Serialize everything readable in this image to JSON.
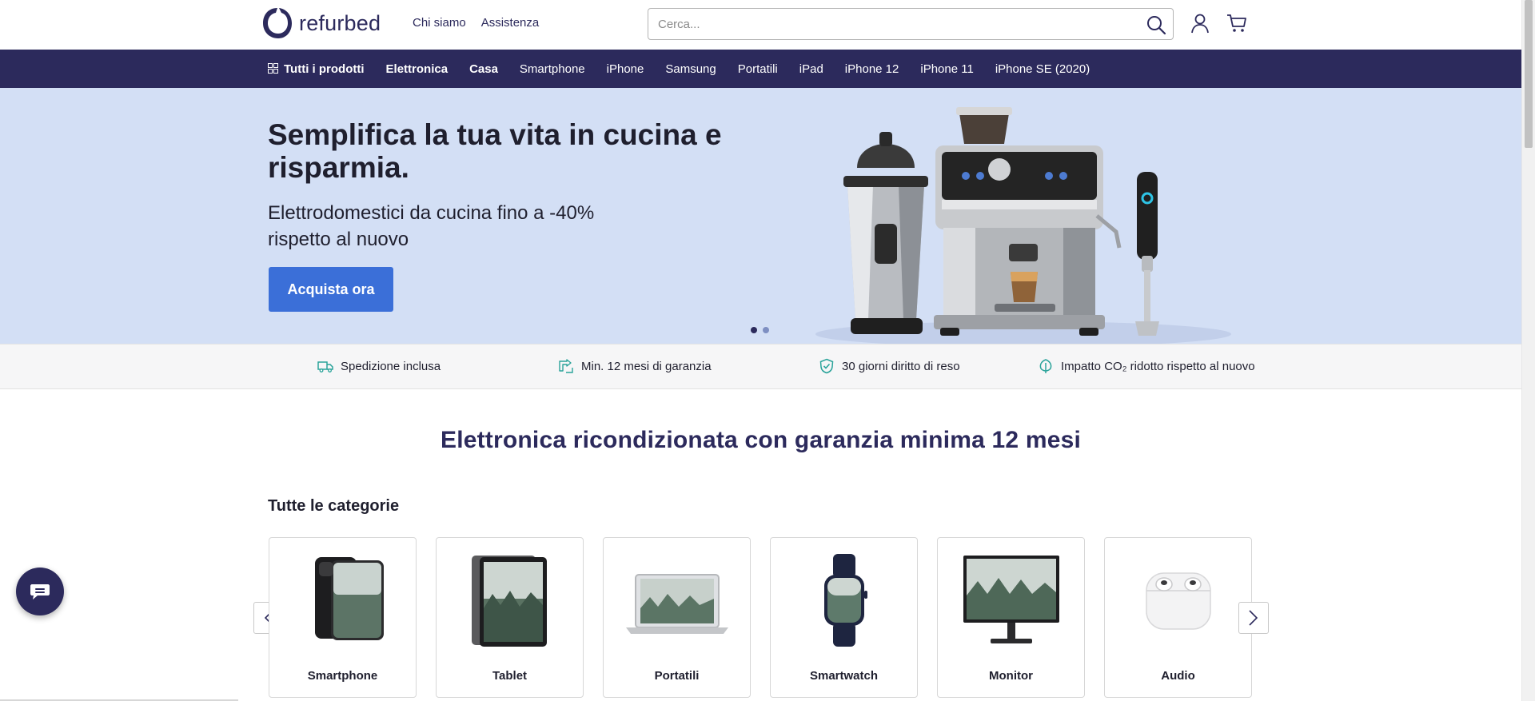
{
  "header": {
    "logo_text": "refurbed",
    "links": [
      "Chi siamo",
      "Assistenza"
    ],
    "search_placeholder": "Cerca..."
  },
  "nav": {
    "items": [
      "Tutti i prodotti",
      "Elettronica",
      "Casa",
      "Smartphone",
      "iPhone",
      "Samsung",
      "Portatili",
      "iPad",
      "iPhone 12",
      "iPhone 11",
      "iPhone SE (2020)"
    ],
    "bold_count": 3
  },
  "hero": {
    "title": "Semplifica la tua vita in cucina e risparmia.",
    "subtitle": "Elettrodomestici da cucina fino a -40% rispetto al nuovo",
    "button_label": "Acquista ora",
    "slides": 2,
    "active_slide": 1,
    "bg_color": "#d3dff5"
  },
  "benefits": [
    {
      "icon": "truck-icon",
      "label": "Spedizione inclusa"
    },
    {
      "icon": "warranty-icon",
      "label": "Min. 12 mesi di garanzia"
    },
    {
      "icon": "shield-check-icon",
      "label": "30 giorni diritto di reso"
    },
    {
      "icon": "leaf-icon",
      "label": "Impatto CO₂ ridotto rispetto al nuovo"
    }
  ],
  "section": {
    "title": "Elettronica ricondizionata con garanzia minima 12 mesi",
    "categories_heading": "Tutte le categorie",
    "categories": [
      {
        "label": "Smartphone",
        "icon": "smartphone-image"
      },
      {
        "label": "Tablet",
        "icon": "tablet-image"
      },
      {
        "label": "Portatili",
        "icon": "laptop-image"
      },
      {
        "label": "Smartwatch",
        "icon": "smartwatch-image"
      },
      {
        "label": "Monitor",
        "icon": "monitor-image"
      },
      {
        "label": "Audio",
        "icon": "earbuds-image"
      }
    ]
  },
  "colors": {
    "brand": "#2c2a5c",
    "accent": "#3b6fd8",
    "benefit_icon": "#2aa39a"
  }
}
